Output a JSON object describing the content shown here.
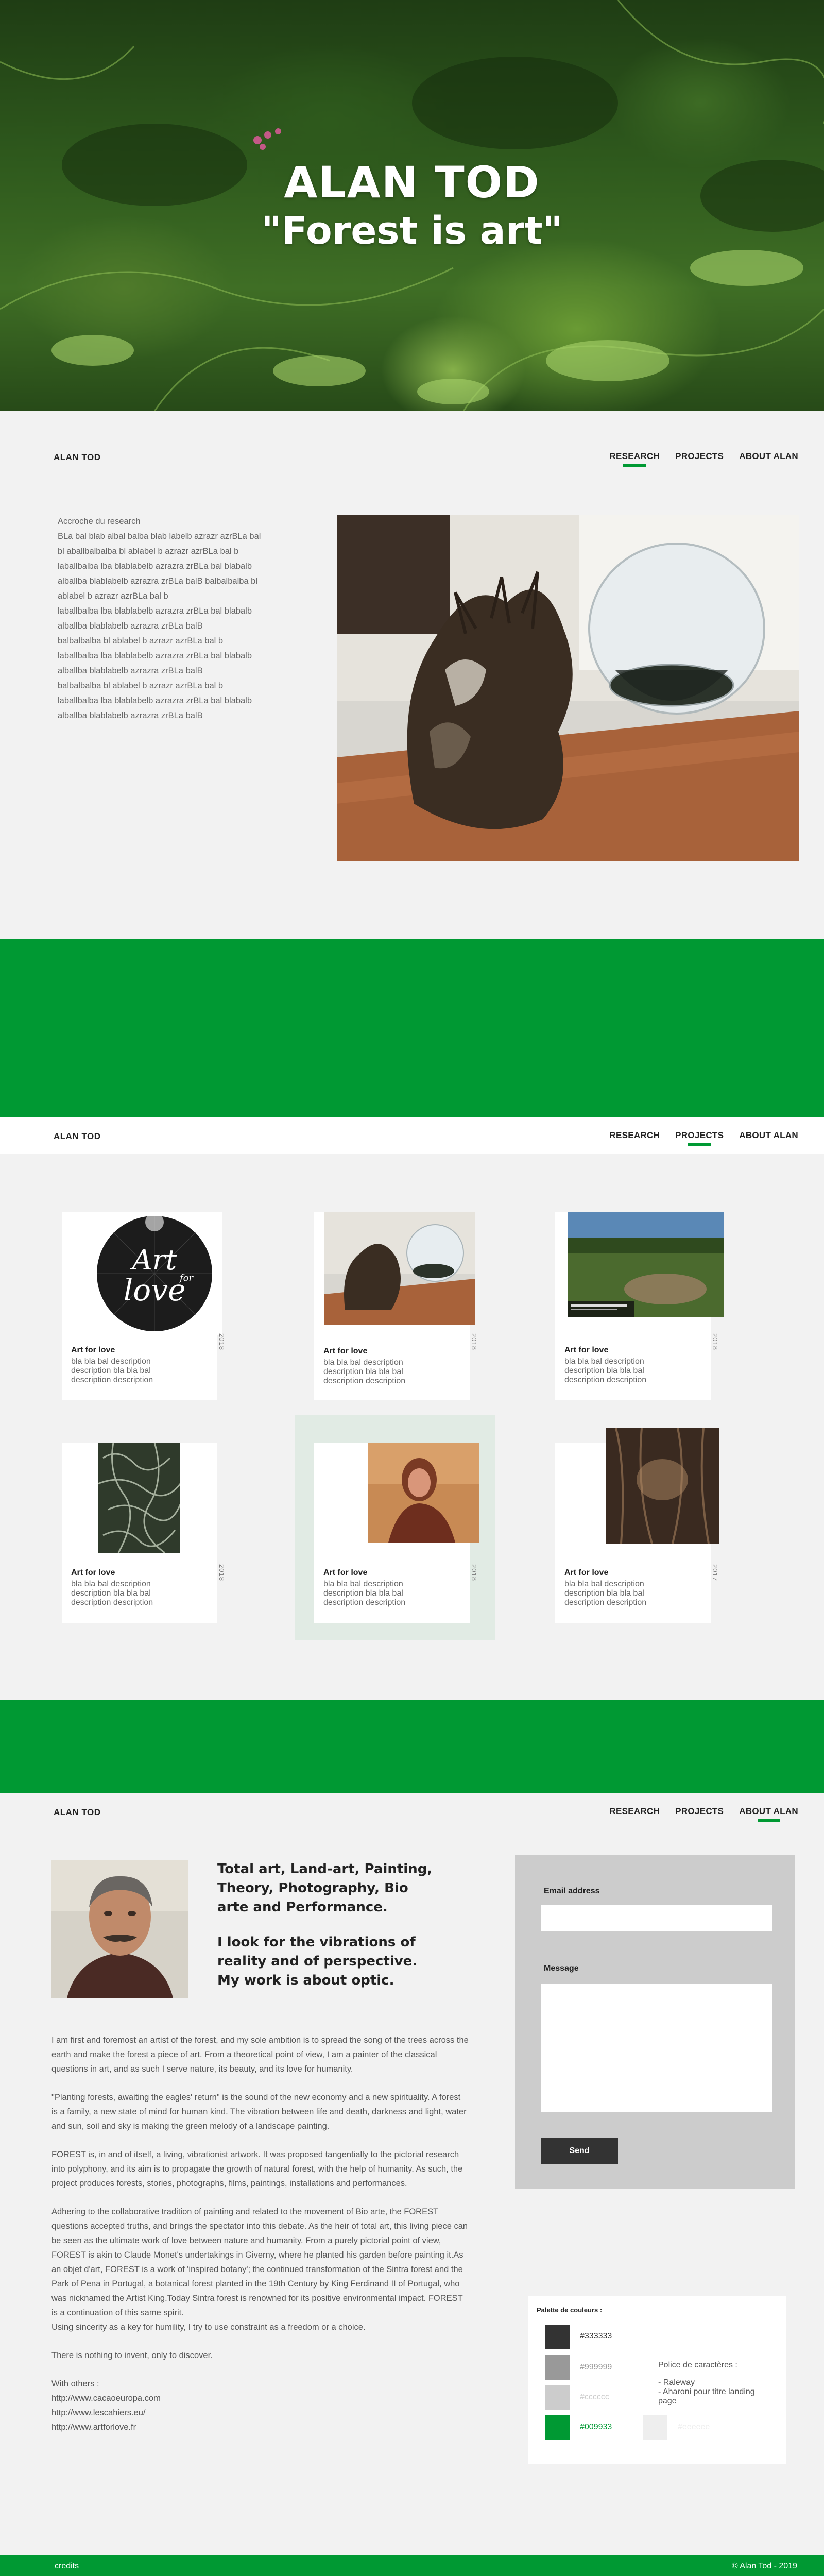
{
  "hero": {
    "title": "ALAN TOD",
    "subtitle": "\"Forest is art\""
  },
  "nav": {
    "brand": "ALAN TOD",
    "links": [
      "RESEARCH",
      "PROJECTS",
      "ABOUT ALAN"
    ]
  },
  "research": {
    "lines": [
      "Accroche du research",
      "BLa bal blab albal balba blab labelb azrazr azrBLa bal",
      "bl aballbalbalba bl ablabel b azrazr azrBLa bal b",
      "laballbalba lba blablabelb azrazra zrBLa bal blabalb",
      "alballba blablabelb azrazra zrBLa balB balbalbalba bl",
      "ablabel b azrazr azrBLa bal b",
      "laballbalba lba blablabelb azrazra zrBLa bal blabalb",
      "alballba blablabelb azrazra zrBLa balB",
      "balbalbalba bl ablabel b azrazr azrBLa bal b",
      "laballbalba lba blablabelb azrazra zrBLa bal blabalb",
      "alballba blablabelb azrazra zrBLa balB",
      "balbalbalba bl ablabel b azrazr azrBLa bal b",
      "laballbalba lba blablabelb azrazra zrBLa bal blabalb",
      "alballba blablabelb azrazra zrBLa balB"
    ]
  },
  "projects": [
    {
      "title": "Art for love",
      "desc": "bla bla bal description description bla bla bal description description",
      "year": "2018",
      "thumb_text": "Art for love"
    },
    {
      "title": "Art for love",
      "desc": "bla bla bal description description bla bla bal description description",
      "year": "2018"
    },
    {
      "title": "Art for love",
      "desc": "bla bla bal description description bla bla bal description description",
      "year": "2018"
    },
    {
      "title": "Art for love",
      "desc": "bla bla bal description description bla bla bal description description",
      "year": "2018"
    },
    {
      "title": "Art for love",
      "desc": "bla bla bal description description bla bla bal description description",
      "year": "2018"
    },
    {
      "title": "Art for love",
      "desc": "bla bla bal description description bla bla bal description description",
      "year": "2017"
    }
  ],
  "about": {
    "headline1": "Total art, Land-art, Painting, Theory, Photography, Bio arte and Performance.",
    "headline2": "I look for the vibrations of reality and of perspective. My work is about optic.",
    "paragraphs": [
      "I am first and foremost an artist of the forest, and my sole ambition is to spread the song of the trees across the earth and make the forest a piece of art. From a theoretical point of view, I am a painter of the classical questions in art, and as such I serve nature, its beauty, and its love for humanity.",
      "\"Planting forests, awaiting the eagles' return\" is the sound of the new economy and a new spirituality.  A forest is a family, a new state of mind for human kind. The vibration between life and death, darkness and light, water and sun, soil and sky is making the green melody of a landscape painting.",
      "FOREST is, in and of itself, a living, vibrationist artwork. It was proposed tangentially to the pictorial research into polyphony, and its aim is to propagate the growth of natural forest, with the help of humanity. As such, the project produces forests, stories, photographs, films, paintings, installations and performances.",
      "Adhering to the collaborative tradition of painting and related to the movement of Bio arte, the FOREST questions accepted truths, and brings the spectator into this debate. As the heir of total art, this living piece can be seen as the ultimate work of love between nature and humanity. From a purely pictorial point of view, FOREST is akin to Claude Monet's undertakings in Giverny, where he planted his garden before painting it.As an objet d'art, FOREST is a work of 'inspired botany'; the continued transformation of the Sintra forest and the Park of Pena in Portugal, a botanical forest planted in the 19th Century by King Ferdinand II of Portugal, who was nicknamed the Artist King.Today Sintra forest is renowned for its positive environmental impact. FOREST is a continuation of this same spirit.\nUsing sincerity as a key for humility, I try to use constraint as a freedom or a choice.",
      "There is nothing to invent, only to discover."
    ],
    "with_others": "With others :",
    "links": [
      "http://www.cacaoeuropa.com",
      "http://www.lescahiers.eu/",
      "http://www.artforlove.fr"
    ]
  },
  "form": {
    "email_label": "Email address",
    "message_label": "Message",
    "send_label": "Send"
  },
  "palette": {
    "title": "Palette de couleurs :",
    "colors": [
      {
        "hex": "#333333",
        "label": "#333333",
        "text_color": "#333333"
      },
      {
        "hex": "#999999",
        "label": "#999999",
        "text_color": "#999999"
      },
      {
        "hex": "#cccccc",
        "label": "#cccccc",
        "text_color": "#cccccc"
      },
      {
        "hex": "#009933",
        "label": "#009933",
        "text_color": "#009933"
      }
    ],
    "extra_color": {
      "hex": "#eeeeee",
      "label": "#eeeeee"
    },
    "font_title": "Police de caractères :",
    "font_lines": [
      "- Raleway",
      "- Aharoni pour titre landing page"
    ]
  },
  "footer": {
    "credits": "credits",
    "copyright": "© Alan Tod - 2019"
  },
  "colors": {
    "accent": "#009933",
    "dark": "#333333",
    "background": "#f2f2f2"
  }
}
